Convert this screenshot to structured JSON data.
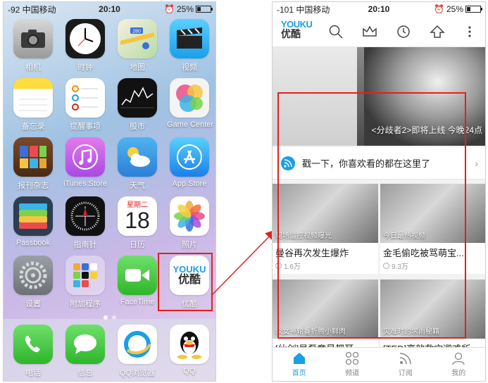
{
  "left_phone": {
    "status": {
      "signal": "-92 中国移动",
      "time": "20:10",
      "battery": "25%",
      "battery_fraction": 0.25
    },
    "apps": [
      {
        "label": "相机",
        "icon": "camera-icon"
      },
      {
        "label": "时钟",
        "icon": "clock-icon"
      },
      {
        "label": "地图",
        "icon": "maps-icon",
        "badge_text": "280"
      },
      {
        "label": "视频",
        "icon": "video-icon"
      },
      {
        "label": "备忘录",
        "icon": "notes-icon"
      },
      {
        "label": "提醒事项",
        "icon": "reminders-icon"
      },
      {
        "label": "股市",
        "icon": "stocks-icon"
      },
      {
        "label": "Game Center",
        "icon": "game-center-icon"
      },
      {
        "label": "报刊杂志",
        "icon": "newsstand-icon"
      },
      {
        "label": "iTunes Store",
        "icon": "itunes-icon"
      },
      {
        "label": "天气",
        "icon": "weather-icon"
      },
      {
        "label": "App Store",
        "icon": "app-store-icon"
      },
      {
        "label": "Passbook",
        "icon": "passbook-icon"
      },
      {
        "label": "指南针",
        "icon": "compass-icon"
      },
      {
        "label": "日历",
        "icon": "calendar-icon",
        "weekday": "星期二",
        "day": "18"
      },
      {
        "label": "照片",
        "icon": "photos-icon"
      },
      {
        "label": "设置",
        "icon": "settings-icon"
      },
      {
        "label": "附加程序",
        "icon": "extras-folder-icon"
      },
      {
        "label": "FaceTime",
        "icon": "facetime-icon"
      },
      {
        "label": "优酷",
        "icon": "youku-icon",
        "logo_en": "YOUKU",
        "logo_cn": "优酷"
      }
    ],
    "dock": [
      {
        "label": "电话",
        "icon": "phone-icon"
      },
      {
        "label": "信息",
        "icon": "messages-icon"
      },
      {
        "label": "QQ浏览器",
        "icon": "qq-browser-icon"
      },
      {
        "label": "QQ",
        "icon": "qq-icon"
      }
    ]
  },
  "right_phone": {
    "status": {
      "signal": "-101 中国移动",
      "time": "20:10",
      "battery": "25%",
      "battery_fraction": 0.25
    },
    "header": {
      "logo_en": "YOUKU",
      "logo_cn": "优酷"
    },
    "banner": {
      "caption": "<分歧者2>即将上线 今晚24点"
    },
    "recommend": {
      "text": "戳一下，你喜欢看的都在这里了"
    },
    "videos": [
      {
        "tag": "现场监控视频曝光",
        "title": "曼谷再次发生爆炸",
        "views": "1.6万"
      },
      {
        "tag": "今日最热视频",
        "title": "金毛偷吃被骂萌宝...",
        "views": "9.3万"
      },
      {
        "tag": "众女神轮番折腾小鲜肉",
        "title": "[仙剑]吴磊竟是耙耳...",
        "views": ""
      },
      {
        "tag": "灾难时的求雨秘籍",
        "title": "[TED]高效救灾避难所",
        "views": ""
      }
    ],
    "tabs": [
      {
        "label": "首页",
        "icon": "home-icon"
      },
      {
        "label": "频道",
        "icon": "channels-icon"
      },
      {
        "label": "订阅",
        "icon": "subscribe-icon"
      },
      {
        "label": "我的",
        "icon": "profile-icon"
      }
    ]
  }
}
